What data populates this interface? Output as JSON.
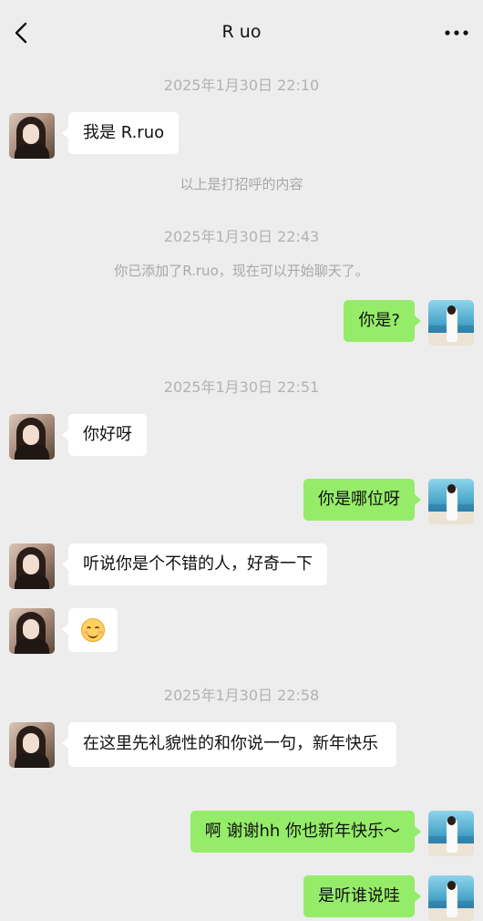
{
  "header": {
    "title": "R uo",
    "back_icon": "chevron-left-icon",
    "more_icon": "more-dots-icon"
  },
  "timestamps": [
    "2025年1月30日 22:10",
    "2025年1月30日 22:43",
    "2025年1月30日 22:51",
    "2025年1月30日 22:58"
  ],
  "system_notes": [
    "以上是打招呼的内容",
    "你已添加了R.ruo，现在可以开始聊天了。"
  ],
  "messages": [
    {
      "sender": "them",
      "text": "我是 R.ruo"
    },
    {
      "sender": "me",
      "text": "你是?"
    },
    {
      "sender": "them",
      "text": "你好呀"
    },
    {
      "sender": "me",
      "text": "你是哪位呀"
    },
    {
      "sender": "them",
      "text": "听说你是个不错的人，好奇一下"
    },
    {
      "sender": "them",
      "emoji": "smiling-face-emoji"
    },
    {
      "sender": "them",
      "text": "在这里先礼貌性的和你说一句，新年快乐"
    },
    {
      "sender": "me",
      "text": "啊 谢谢hh 你也新年快乐～"
    },
    {
      "sender": "me",
      "text": "是听谁说哇"
    }
  ],
  "colors": {
    "background": "#ededed",
    "bubble_them": "#ffffff",
    "bubble_me": "#95ec69",
    "timestamp_text": "#b2b2b2"
  }
}
